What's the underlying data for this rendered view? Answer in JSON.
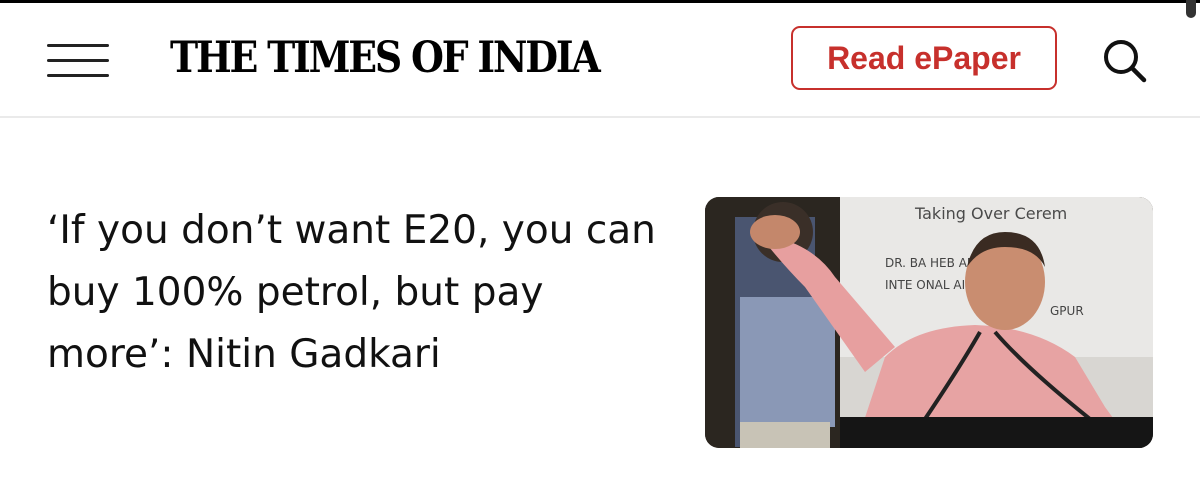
{
  "header": {
    "logo": "THE TIMES OF INDIA",
    "epaper_label": "Read ePaper",
    "menu_icon": "hamburger-menu-icon",
    "search_icon": "search-icon"
  },
  "article": {
    "headline": "‘If you don’t want E20, you can buy 100% petrol, but pay more’: Nitin Gadkari",
    "image_sign_lines": [
      "Taking Over Cerem",
      "DR. BA    HEB AMBE",
      "INTE    ONAL AIRP",
      "GPUR"
    ]
  },
  "colors": {
    "accent": "#c7302c",
    "text": "#111111",
    "divider": "#eaeaea"
  }
}
